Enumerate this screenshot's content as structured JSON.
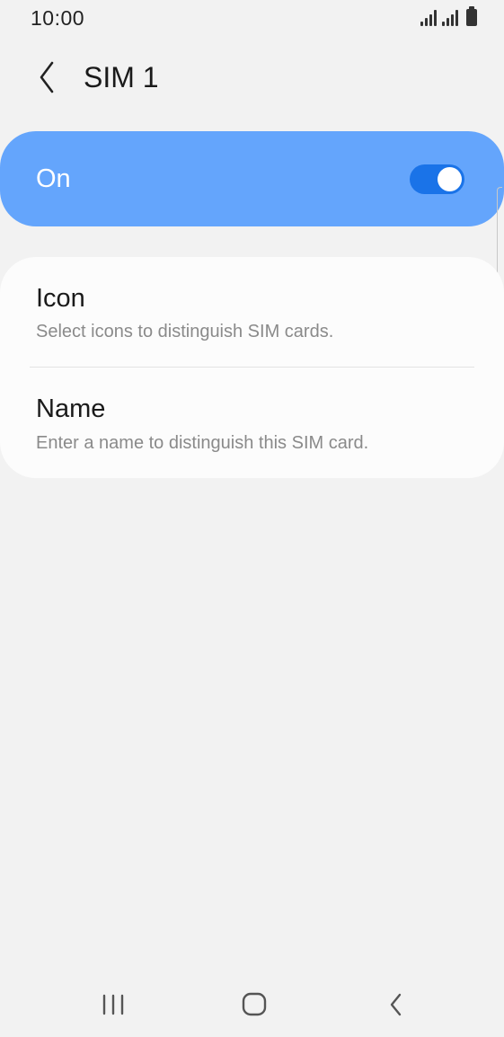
{
  "status_bar": {
    "time": "10:00",
    "icons": [
      "signal-sim1-icon",
      "signal-sim2-icon",
      "battery-icon"
    ]
  },
  "header": {
    "title": "SIM 1",
    "back_icon": "chevron-left-icon"
  },
  "master_switch": {
    "label": "On",
    "enabled": true,
    "background_color": "#64a5fc",
    "toggle_color": "#1a73e8"
  },
  "settings": [
    {
      "title": "Icon",
      "summary": "Select icons to distinguish SIM cards."
    },
    {
      "title": "Name",
      "summary": "Enter a name to distinguish this SIM card."
    }
  ],
  "nav_bar": {
    "buttons": [
      "recent-apps-icon",
      "home-icon",
      "back-icon"
    ]
  }
}
